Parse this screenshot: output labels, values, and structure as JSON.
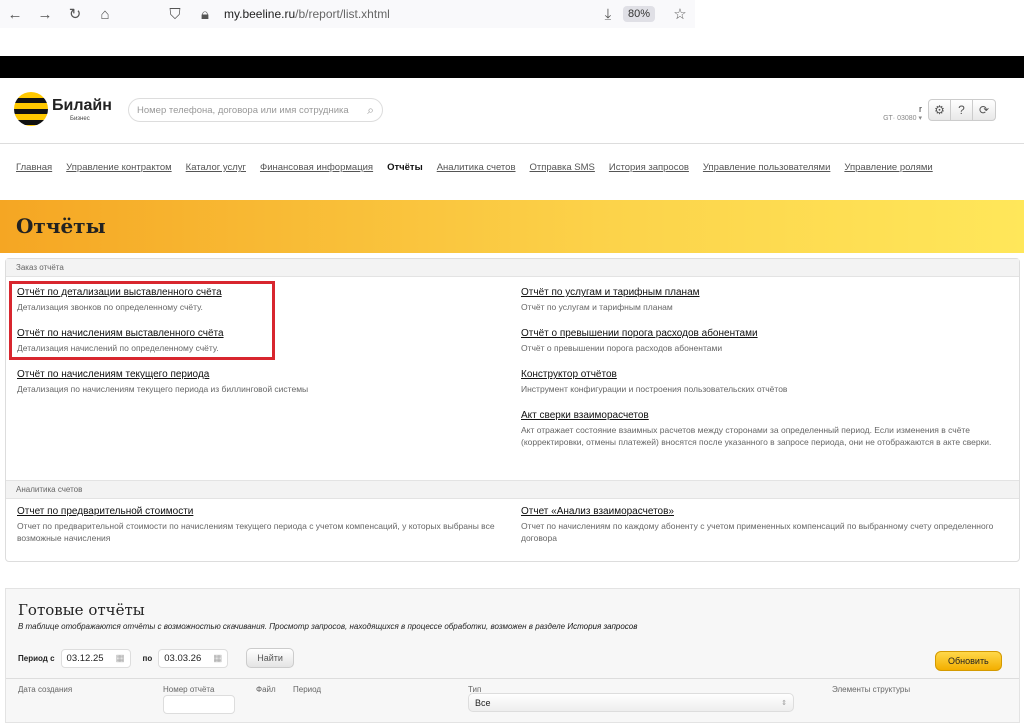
{
  "browser": {
    "url_domain": "my.beeline.ru",
    "url_path": "/b/report/list.xhtml",
    "zoom": "80%"
  },
  "header": {
    "brand": "Билайн",
    "brand_sub": "Бизнес",
    "search_placeholder": "Номер телефона, договора или имя сотрудника",
    "user_initial": "r",
    "user_line": "GT·  03080 ▾"
  },
  "nav": [
    "Главная",
    "Управление контрактом",
    "Каталог услуг",
    "Финансовая информация",
    "Отчёты",
    "Аналитика счетов",
    "Отправка SMS",
    "История запросов",
    "Управление пользователями",
    "Управление ролями"
  ],
  "page_title": "Отчёты",
  "order": {
    "section": "Заказ отчёта",
    "items": [
      {
        "title": "Отчёт по детализации выставленного счёта",
        "desc": "Детализация звонков по определенному счёту."
      },
      {
        "title": "Отчёт по начислениям выставленного счёта",
        "desc": "Детализация начислений по определенному счёту."
      },
      {
        "title": "Отчёт по начислениям текущего периода",
        "desc": "Детализация по начислениям текущего периода из биллинговой системы"
      },
      {
        "title": "Отчёт по услугам и тарифным планам",
        "desc": "Отчёт по услугам и тарифным планам"
      },
      {
        "title": "Отчёт о превышении порога расходов абонентами",
        "desc": "Отчёт о превышении порога расходов абонентами"
      },
      {
        "title": "Конструктор отчётов",
        "desc": "Инструмент конфигурации и построения пользовательских отчётов"
      },
      {
        "title": "Акт сверки взаиморасчетов",
        "desc": "Акт отражает состояние взаимных расчетов между сторонами за определенный период. Если изменения в счёте (корректировки, отмены платежей) вносятся после указанного в запросе периода, они не отображаются в акте сверки."
      }
    ]
  },
  "analytics": {
    "section": "Аналитика счетов",
    "items": [
      {
        "title": "Отчет по предварительной стоимости",
        "desc": "Отчет по предварительной стоимости по начислениям текущего периода с учетом компенсаций, у которых выбраны все возможные начисления"
      },
      {
        "title": "Отчет «Анализ взаиморасчетов»",
        "desc": "Отчет по начислениям по каждому абоненту с учетом примененных компенсаций по выбранному счету определенного договора"
      }
    ]
  },
  "ready": {
    "title": "Готовые отчёты",
    "desc": "В таблице отображаются отчёты с возможностью скачивания. Просмотр запросов, находящихся в процессе обработки, возможен в разделе ",
    "desc_link": "История запросов",
    "period_from_label": "Период с",
    "date_from": "03.12.25",
    "period_to_label": "по",
    "date_to": "03.03.26",
    "find": "Найти",
    "refresh": "Обновить",
    "columns": [
      "Дата создания",
      "Номер отчёта",
      "Файл",
      "Период",
      "Тип",
      "Элементы структуры"
    ],
    "type_value": "Все"
  }
}
